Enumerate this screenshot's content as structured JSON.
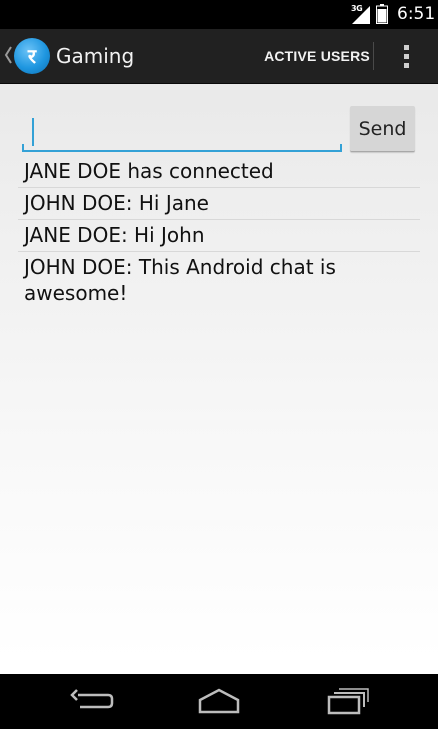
{
  "status_bar": {
    "network_label": "3G",
    "time": "6:51"
  },
  "action_bar": {
    "logo_glyph": "र",
    "title": "Gaming",
    "active_users_label": "ACTIVE USERS"
  },
  "composer": {
    "input_value": "",
    "send_label": "Send"
  },
  "messages": [
    "JANE DOE has connected",
    "JOHN DOE: Hi Jane",
    "JANE DOE: Hi John",
    "JOHN DOE: This Android chat is awesome!"
  ],
  "colors": {
    "accent": "#33a1d6",
    "action_bar_bg": "#212121",
    "logo_blue": "#1e96e0"
  },
  "icons": {
    "status": [
      "signal-icon",
      "battery-icon"
    ],
    "action_bar": [
      "up-caret-icon",
      "overflow-menu-icon"
    ],
    "navigation": [
      "back-icon",
      "home-icon",
      "recents-icon"
    ]
  }
}
